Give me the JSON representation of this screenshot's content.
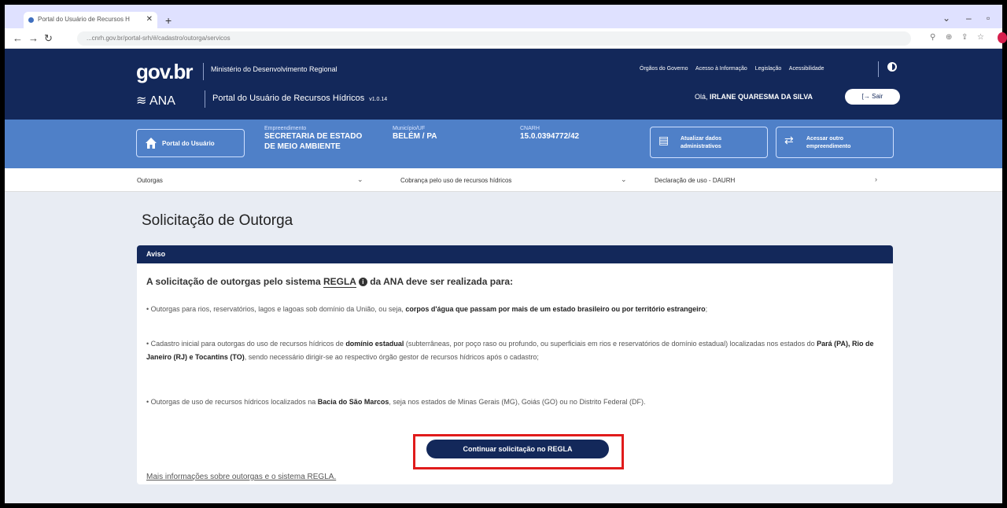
{
  "browser": {
    "tab_title": "Portal do Usuário de Recursos H",
    "url": "...cnrh.gov.br/portal-srh/#/cadastro/outorga/servicos"
  },
  "header": {
    "logo": "gov.br",
    "ministry": "Ministério do Desenvolvimento Regional",
    "ana_mark": "ANA",
    "portal_title": "Portal do Usuário de Recursos Hídricos",
    "version": "v1.0.14",
    "links": [
      "Órgãos do Governo",
      "Acesso à Informação",
      "Legislação",
      "Acessibilidade"
    ],
    "greeting_prefix": "Olá,",
    "user_name": "IRLANE QUARESMA DA SILVA",
    "logout_label": "Sair"
  },
  "enterprise_bar": {
    "portal_button": "Portal do Usuário",
    "enterprise_label": "Empreendimento",
    "enterprise_value_line1": "SECRETARIA DE ESTADO",
    "enterprise_value_line2": "DE MEIO AMBIENTE",
    "city_label": "Município/UF",
    "city_value": "BELÉM / PA",
    "cnarh_label": "CNARH",
    "cnarh_value": "15.0.0394772/42",
    "update_button_line1": "Atualizar dados",
    "update_button_line2": "administrativos",
    "switch_button_line1": "Acessar outro",
    "switch_button_line2": "empreendimento"
  },
  "menu": {
    "item1": "Outorgas",
    "item2": "Cobrança pelo uso de recursos hídricos",
    "item3": "Declaração de uso - DAURH"
  },
  "main": {
    "page_title": "Solicitação de Outorga",
    "card_header": "Aviso",
    "intro_before": "A solicitação de outorgas pelo sistema",
    "intro_regla": "REGLA",
    "intro_after": "da ANA deve ser realizada para:",
    "p1_text": "• Outorgas para rios, reservatórios, lagos e lagoas sob domínio da União, ou seja,",
    "p1_bold": "corpos d'água que passam por mais de um estado brasileiro ou por território estrangeiro",
    "p1_end": ";",
    "p2_a": "• Cadastro inicial para outorgas do uso de recursos hídricos de",
    "p2_bold1": "domínio estadual",
    "p2_b": "(subterrâneas, por poço raso ou profundo, ou superficiais em rios e reservatórios de domínio estadual) localizadas nos estados do",
    "p2_bold2": "Pará (PA), Rio de Janeiro (RJ) e Tocantins (TO)",
    "p2_c": ", sendo necessário dirigir-se ao respectivo órgão gestor de recursos hídricos após o cadastro;",
    "p3_a": "• Outorgas de uso de recursos hídricos localizados na",
    "p3_bold": "Bacia do São Marcos",
    "p3_b": ", seja nos estados de Minas Gerais (MG), Goiás (GO) ou no Distrito Federal (DF).",
    "continue_button": "Continuar solicitação no REGLA",
    "more_link": "Mais informações sobre outorgas e o sistema REGLA."
  },
  "colors": {
    "navy": "#13285a",
    "blue_bar": "#4f80c8",
    "highlight": "#e01b1b"
  }
}
